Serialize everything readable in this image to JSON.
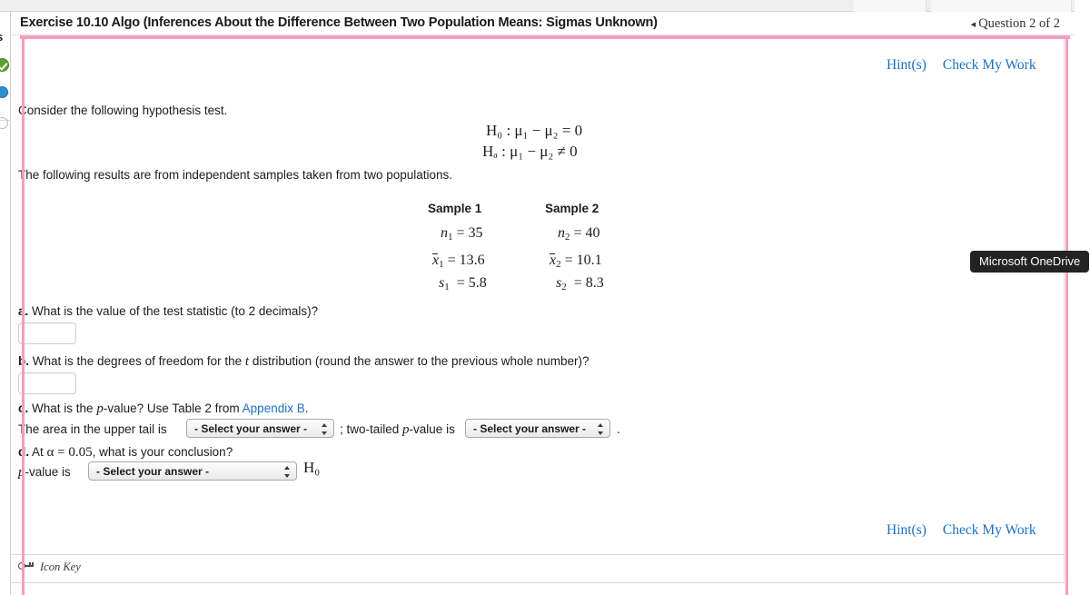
{
  "browser": {
    "tabs": [
      "",
      ""
    ]
  },
  "sidebar": {
    "label": "s",
    "icons": [
      "check-circle-icon",
      "blue-dot-icon",
      "empty-circle-icon"
    ]
  },
  "header": {
    "title": "Exercise 10.10 Algo (Inferences About the Difference Between Two Population Means: Sigmas Unknown)",
    "prev_arrow": "◂",
    "question_nav": "Question 2 of 2"
  },
  "toolbar_top": {
    "hints_label": "Hint(s)",
    "check_label": "Check My Work"
  },
  "toolbar_bottom": {
    "hints_label": "Hint(s)",
    "check_label": "Check My Work"
  },
  "question": {
    "intro": "Consider the following hypothesis test.",
    "hypotheses": {
      "null": "H₀ : μ₁ − μ₂ = 0",
      "alt": "Hₐ : μ₁ − μ₂ ≠ 0"
    },
    "results_intro": "The following results are from independent samples taken from two populations.",
    "samples": {
      "headers": [
        "Sample 1",
        "Sample 2"
      ],
      "rows": [
        {
          "left": "n₁ = 35",
          "right": "n₂ = 40"
        },
        {
          "left": "x̄₁ = 13.6",
          "right": "x̄₂ = 10.1"
        },
        {
          "left": "s₁  = 5.8",
          "right": "s₂  = 8.3"
        }
      ],
      "values": {
        "n1": 35,
        "n2": 40,
        "xbar1": 13.6,
        "xbar2": 10.1,
        "s1": 5.8,
        "s2": 8.3
      }
    },
    "parts": {
      "a": {
        "marker": "a.",
        "text": "What is the value of the test statistic (to 2 decimals)?",
        "input_value": ""
      },
      "b": {
        "marker": "b.",
        "text_before_t": "What is the degrees of freedom for the",
        "t_symbol": "t",
        "text_after_t": "distribution (round the answer to the previous whole number)?",
        "input_value": ""
      },
      "c": {
        "marker": "c.",
        "text_1": "What is the",
        "p_symbol": "p",
        "text_2": "-value? Use Table 2 from",
        "link_label": "Appendix B",
        "text_3": ".",
        "line2_prefix": "The area in the upper tail is",
        "select1_value": "- Select your answer -",
        "line2_middle_a": "; two-tailed",
        "line2_middle_b": "-value is",
        "select2_value": "- Select your answer -",
        "line2_suffix": "."
      },
      "d": {
        "marker": "d.",
        "text_alpha_prefix": "At",
        "alpha_expr": "α = 0.05",
        "text_after_alpha": ", what is your conclusion?",
        "line2_prefix_p": "p",
        "line2_prefix": "-value is",
        "select_value": "- Select your answer -",
        "h0_label": "H₀"
      }
    }
  },
  "footer": {
    "icon_key_label": "Icon Key",
    "icon_key_glyph": "key-icon"
  },
  "overlay": {
    "tooltip_text": "Microsoft OneDrive",
    "highlight_color": "#f59ec0"
  }
}
